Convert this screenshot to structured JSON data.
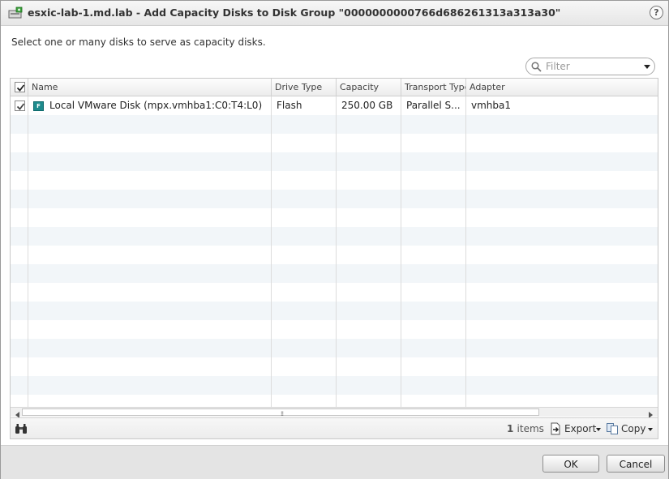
{
  "dialog": {
    "title": "esxic-lab-1.md.lab - Add Capacity Disks to Disk Group \"0000000000766d686261313a313a30\"",
    "help_label": "?",
    "instruction": "Select one or many disks to serve as capacity disks."
  },
  "filter": {
    "placeholder": "Filter",
    "value": ""
  },
  "table": {
    "select_all_checked": true,
    "columns": [
      "Name",
      "Drive Type",
      "Capacity",
      "Transport Type",
      "Adapter"
    ],
    "rows": [
      {
        "checked": true,
        "drive_badge": "F",
        "name": "Local VMware Disk (mpx.vmhba1:C0:T4:L0)",
        "drive_type": "Flash",
        "capacity": "250.00 GB",
        "transport_type": "Parallel S...",
        "adapter": "vmhba1"
      }
    ]
  },
  "footer": {
    "count_value": "1",
    "count_label": "items",
    "export_label": "Export",
    "copy_label": "Copy"
  },
  "buttons": {
    "ok": "OK",
    "cancel": "Cancel"
  },
  "icons": {
    "host": "host-icon",
    "help": "help-icon",
    "search": "search-icon",
    "flash": "flash-disk-icon",
    "find": "binoculars-icon",
    "export": "export-icon",
    "copy": "copy-icon"
  },
  "colors": {
    "flash_badge": "#1d8a8c",
    "row_alt": "#f2f6f9"
  }
}
